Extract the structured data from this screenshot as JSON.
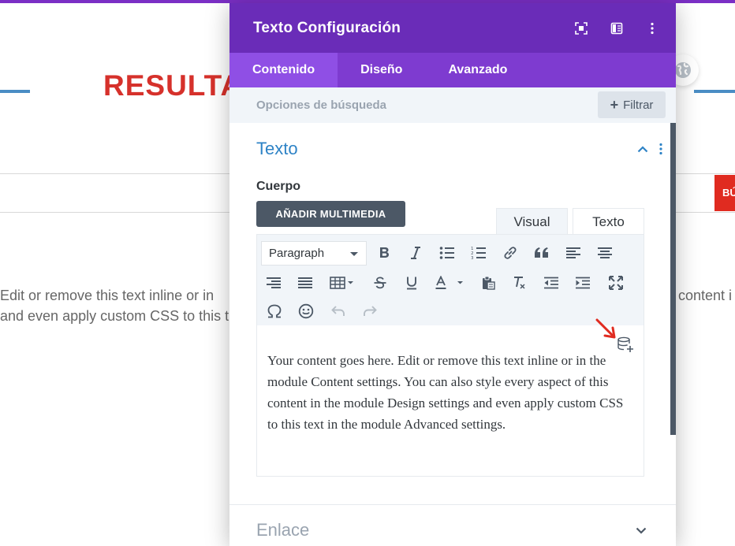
{
  "background": {
    "heading": "RESULTA",
    "search_button": "BÚ",
    "text_left_line1": "Edit or remove this text inline or in",
    "text_left_line2": "and even apply custom CSS to this t",
    "text_right_line1": "content i"
  },
  "modal": {
    "title": "Texto Configuración",
    "tabs": [
      {
        "label": "Contenido",
        "active": true
      },
      {
        "label": "Diseño",
        "active": false
      },
      {
        "label": "Avanzado",
        "active": false
      }
    ],
    "search": {
      "placeholder": "Opciones de búsqueda"
    },
    "filter_label": "Filtrar",
    "section": {
      "title": "Texto",
      "field_label": "Cuerpo",
      "media_button": "AÑADIR MULTIMEDIA",
      "editor_tabs": {
        "visual": "Visual",
        "text": "Texto"
      },
      "format_select": "Paragraph",
      "content": "Your content goes here. Edit or remove this text inline or in the module Content settings. You can also style every aspect of this content in the module Design settings and even apply custom CSS to this text in the module Advanced settings."
    },
    "section2": {
      "title": "Enlace"
    }
  },
  "colors": {
    "header": "#6a2cb8",
    "tabs": "#7e3bd0",
    "active_tab": "#8f4fe5",
    "section_title": "#2e83c6",
    "accent_red": "#e02b20"
  },
  "icons": {
    "header": [
      "expand-icon",
      "split-view-icon",
      "more-vertical-icon"
    ],
    "toolbar": [
      "bold-icon",
      "italic-icon",
      "bulleted-list-icon",
      "numbered-list-icon",
      "link-icon",
      "blockquote-icon",
      "align-left-icon",
      "align-center-icon",
      "align-right-icon",
      "align-justify-icon",
      "table-icon",
      "strikethrough-icon",
      "underline-icon",
      "text-color-icon",
      "paste-icon",
      "clear-formatting-icon",
      "outdent-icon",
      "indent-icon",
      "fullscreen-icon",
      "special-character-icon",
      "emoji-icon",
      "undo-icon",
      "redo-icon"
    ]
  }
}
